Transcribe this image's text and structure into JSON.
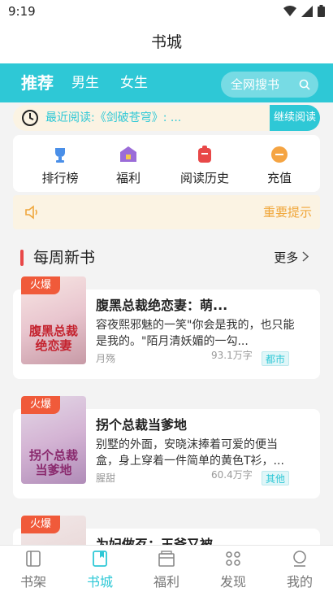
{
  "status_bar": {
    "time": "9:19"
  },
  "header": {
    "title": "书城"
  },
  "tabs": [
    {
      "label": "推荐"
    },
    {
      "label": "男生"
    },
    {
      "label": "女生"
    }
  ],
  "search": {
    "label": "全网搜书"
  },
  "recent": {
    "text": "最近阅读:《剑破苍穹》: ...",
    "button": "继续阅读"
  },
  "menu": [
    {
      "label": "排行榜",
      "icon": "trophy-icon"
    },
    {
      "label": "福利",
      "icon": "gift-icon"
    },
    {
      "label": "阅读历史",
      "icon": "history-icon"
    },
    {
      "label": "充值",
      "icon": "coin-icon"
    }
  ],
  "notice": {
    "text": "重要提示"
  },
  "section": {
    "title": "每周新书",
    "more": "更多"
  },
  "books": [
    {
      "badge": "火爆",
      "cover_text": "腹黑总裁绝恋妻",
      "title": "腹黑总裁绝恋妻：萌...",
      "desc": "容夜熙邪魅的一笑\"你会是我的，也只能是我的。\"陌月清妖媚的一勾...",
      "author": "月殇",
      "words": "93.1万字",
      "tag": "都市"
    },
    {
      "badge": "火爆",
      "cover_text": "拐个总裁当爹地",
      "title": "拐个总裁当爹地",
      "desc": "别墅的外面，安晓沫捧着可爱的便当盒，身上穿着一件简单的黄色T衫，...",
      "author": "腥甜",
      "words": "60.4万字",
      "tag": "其他"
    },
    {
      "badge": "火爆",
      "cover_text": "",
      "title": "为妃做歹：王爷又被...",
      "desc": "",
      "author": "",
      "words": "",
      "tag": ""
    }
  ],
  "bottom_nav": [
    {
      "label": "书架",
      "icon": "bookshelf-icon",
      "active": false
    },
    {
      "label": "书城",
      "icon": "bookstore-icon",
      "active": true
    },
    {
      "label": "福利",
      "icon": "welfare-icon",
      "active": false
    },
    {
      "label": "发现",
      "icon": "discover-icon",
      "active": false
    },
    {
      "label": "我的",
      "icon": "profile-icon",
      "active": false
    }
  ],
  "colors": {
    "accent": "#2ec8d6",
    "hot": "#f05a3a",
    "notice": "#f0a63a"
  }
}
